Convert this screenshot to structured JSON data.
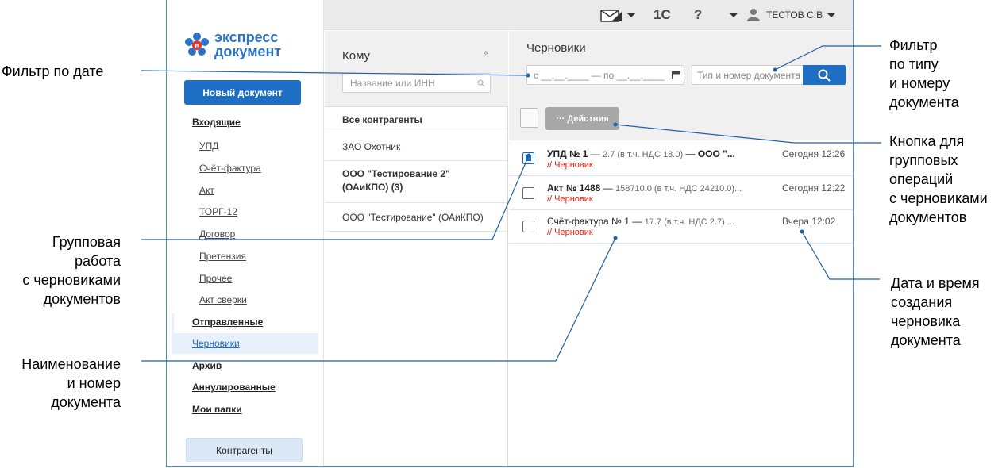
{
  "annotations": {
    "date_filter": "Фильтр по дате",
    "type_filter": "Фильтр\nпо типу\nи номеру\nдокумента",
    "group_button": "Кнопка для\nгрупповых\nопераций\nс черновиками\nдокументов",
    "group_work": "Групповая\nработа\nс черновиками\nдокументов",
    "datetime": "Дата и время\nсоздания\nчерновика\nдокумента",
    "doc_name": "Наименование\nи номер\nдокумента"
  },
  "topbar": {
    "brand_1c": "1С",
    "help": "?",
    "user": "ТЕСТОВ С.В"
  },
  "logo": {
    "line1": "экспресс",
    "line2": "документ"
  },
  "sidebar": {
    "new_doc": "Новый документ",
    "incoming": "Входящие",
    "sub": [
      "УПД",
      "Счёт-фактура",
      "Акт",
      "ТОРГ-12",
      "Договор",
      "Претензия",
      "Прочее",
      "Акт сверки"
    ],
    "sent": "Отправленные",
    "drafts": "Черновики",
    "archive": "Архив",
    "cancelled": "Аннулированные",
    "folders": "Мои папки",
    "contragents": "Контрагенты"
  },
  "middle": {
    "title": "Кому",
    "collapse": "«",
    "search_placeholder": "Название или ИНН",
    "rows": [
      "Все контрагенты",
      "ЗАО Охотник",
      "ООО \"Тестирование 2\"\n(ОАиКПО) (3)",
      "ООО \"Тестирование\" (ОАиКПО)"
    ]
  },
  "right": {
    "title": "Черновики",
    "date_filter": "с __.__.____ — по __.__.____",
    "type_placeholder": "Тип и номер документа",
    "actions": "··· Действия",
    "docs": [
      {
        "name": "УПД № 1",
        "meta": "2.7 (в т.ч. НДС 18.0)",
        "rest": "— ООО \"...",
        "status": "// Черновик",
        "time": "Сегодня 12:26",
        "checked": true
      },
      {
        "name": "Акт № 1488",
        "meta": "158710.0 (в т.ч. НДС 24210.0)...",
        "rest": "",
        "status": "// Черновик",
        "time": "Сегодня 12:22",
        "checked": false
      },
      {
        "name": "Счёт-фактура № 1",
        "meta": "17.7 (в т.ч. НДС 2.7) ...",
        "rest": "",
        "status": "// Черновик",
        "time": "Вчера 12:02",
        "checked": false
      }
    ]
  },
  "colors": {
    "accent": "#1e6fc4",
    "draft": "#dd2211",
    "frame": "#4a8fd0"
  }
}
